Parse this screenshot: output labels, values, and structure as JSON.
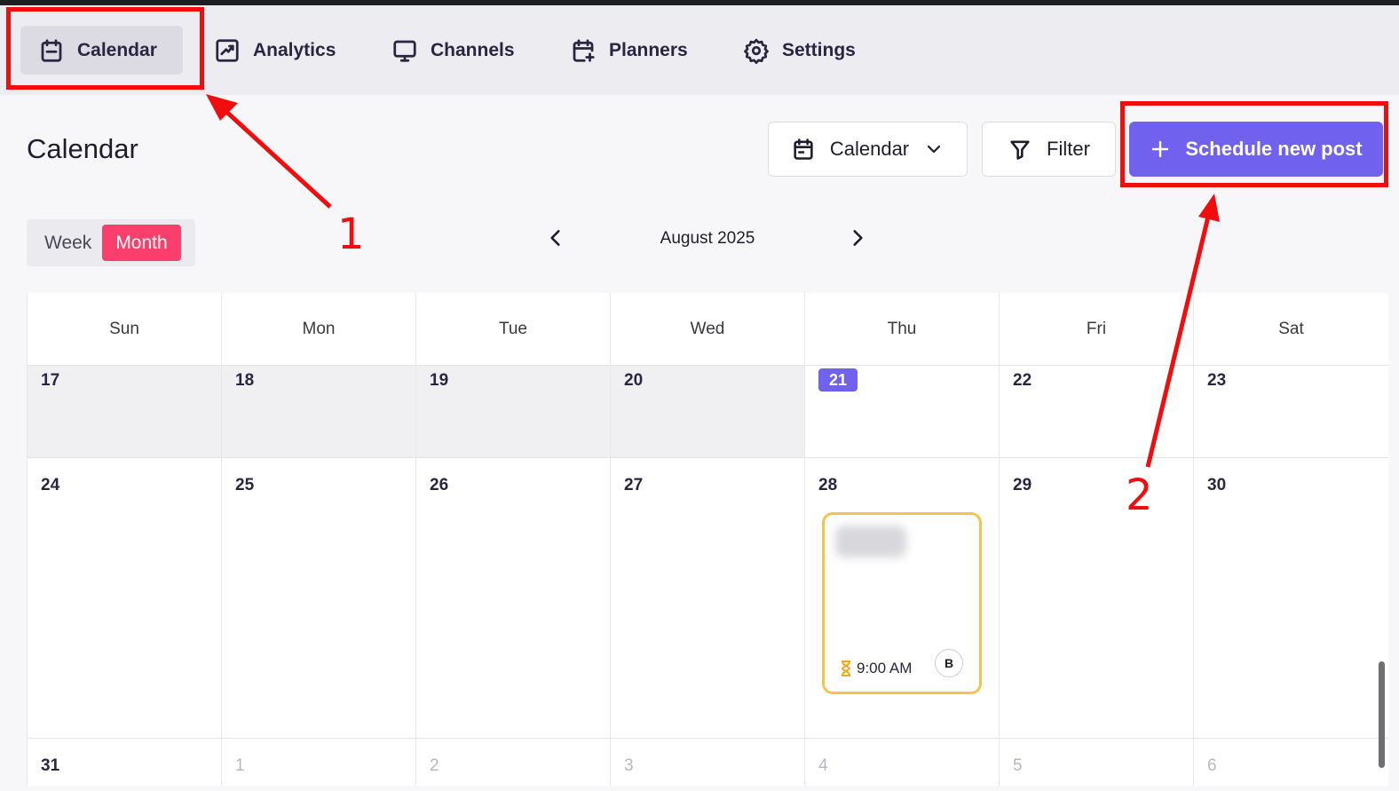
{
  "nav": {
    "items": [
      {
        "label": "Calendar",
        "icon": "calendar-icon",
        "active": true
      },
      {
        "label": "Analytics",
        "icon": "analytics-chart-icon",
        "active": false
      },
      {
        "label": "Channels",
        "icon": "monitor-icon",
        "active": false
      },
      {
        "label": "Planners",
        "icon": "calendar-plus-icon",
        "active": false
      },
      {
        "label": "Settings",
        "icon": "gear-icon",
        "active": false
      }
    ]
  },
  "page": {
    "title": "Calendar"
  },
  "toolbar": {
    "view_select_label": "Calendar",
    "filter_label": "Filter",
    "schedule_label": "Schedule new post"
  },
  "view_toggle": {
    "week_label": "Week",
    "month_label": "Month",
    "selected": "Month"
  },
  "month_nav": {
    "label": "August 2025"
  },
  "calendar": {
    "weekdays": [
      "Sun",
      "Mon",
      "Tue",
      "Wed",
      "Thu",
      "Fri",
      "Sat"
    ],
    "weeks": [
      [
        "17",
        "18",
        "19",
        "20",
        "21",
        "22",
        "23"
      ],
      [
        "24",
        "25",
        "26",
        "27",
        "28",
        "29",
        "30"
      ],
      [
        "31",
        "1",
        "2",
        "3",
        "4",
        "5",
        "6"
      ]
    ],
    "today": "21"
  },
  "event": {
    "time": "9:00 AM",
    "avatar_letter": "B"
  },
  "annotations": {
    "label_1": "1",
    "label_2": "2",
    "color": "#f10d0d"
  },
  "colors": {
    "accent": "#7161ef",
    "month_toggle": "#fb3f6c",
    "event_border": "#f5c44a"
  }
}
